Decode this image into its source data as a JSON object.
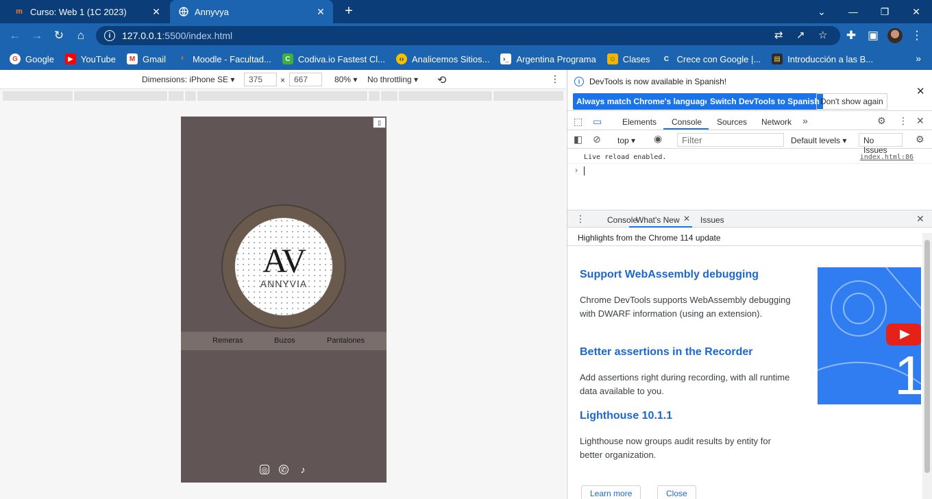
{
  "tabs": [
    {
      "title": "Curso: Web 1 (1C 2023)",
      "active": false
    },
    {
      "title": "Annyvya",
      "active": true
    }
  ],
  "address": {
    "host": "127.0.0.1",
    "path": ":5500/index.html"
  },
  "bookmarks": [
    {
      "label": "Google",
      "icon": "google-icon",
      "color": "#ea4335"
    },
    {
      "label": "YouTube",
      "icon": "youtube-icon",
      "color": "#ff0000"
    },
    {
      "label": "Gmail",
      "icon": "gmail-icon",
      "color": "#d93025"
    },
    {
      "label": "Moodle - Facultad...",
      "icon": "moodle-icon",
      "color": "#f98012"
    },
    {
      "label": "Codiva.io Fastest Cl...",
      "icon": "codiva-icon",
      "color": "#3cb043"
    },
    {
      "label": "Analicemos Sitios...",
      "icon": "code-icon",
      "color": "#f2c200"
    },
    {
      "label": "Argentina Programa",
      "icon": "terminal-icon",
      "color": "#2d2d2d"
    },
    {
      "label": "Clases",
      "icon": "classroom-icon",
      "color": "#f4b400"
    },
    {
      "label": "Crece con Google |...",
      "icon": "crece-icon",
      "color": "#1a73e8"
    },
    {
      "label": "Introducción a las B...",
      "icon": "book-icon",
      "color": "#3a3a3a"
    }
  ],
  "device_toolbar": {
    "dimensions_label": "Dimensions: iPhone SE",
    "width": "375",
    "height": "667",
    "zoom": "80%",
    "throttle": "No throttling"
  },
  "phone": {
    "logo_initials": "AV",
    "logo_name": "ANNYVIA",
    "nav": [
      "Remeras",
      "Buzos",
      "Pantalones"
    ],
    "background": "#625555"
  },
  "devtools": {
    "info_message": "DevTools is now available in Spanish!",
    "btn_match": "Always match Chrome's language",
    "btn_switch": "Switch DevTools to Spanish",
    "btn_dont_show": "Don't show again",
    "tabs": [
      "Elements",
      "Console",
      "Sources",
      "Network"
    ],
    "active_tab": "Console",
    "context": "top",
    "filter_placeholder": "Filter",
    "levels": "Default levels",
    "issues": "No Issues",
    "log_message": "Live reload enabled.",
    "log_source": "index.html:86",
    "drawer_tabs": [
      "Console",
      "What's New",
      "Issues"
    ],
    "highlights": "Highlights from the Chrome 114 update",
    "whats_new": [
      {
        "title": "Support WebAssembly debugging",
        "body": "Chrome DevTools supports WebAssembly debugging with DWARF information (using an extension)."
      },
      {
        "title": "Better assertions in the Recorder",
        "body": "Add assertions right during recording, with all runtime data available to you."
      },
      {
        "title": "Lighthouse 10.1.1",
        "body": "Lighthouse now groups audit results by entity for better organization."
      }
    ],
    "learn_more": "Learn more",
    "close": "Close"
  },
  "colors": {
    "chrome_dark": "#0b3d78",
    "chrome_light": "#1c63b0",
    "accent": "#1a73e8"
  }
}
